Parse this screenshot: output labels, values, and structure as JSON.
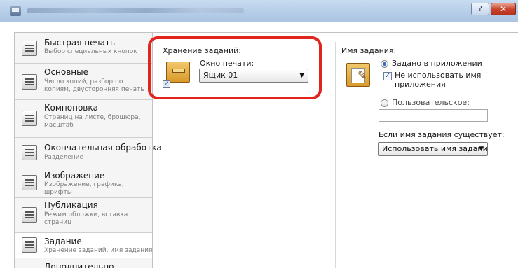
{
  "window": {
    "help_glyph": "?",
    "close_glyph": "✕"
  },
  "sidebar": {
    "items": [
      {
        "title": "Быстрая печать",
        "subtitle": "Выбор специальных кнопок",
        "icon": "quick-print-icon"
      },
      {
        "title": "Основные",
        "subtitle": "Число копий, разбор по копиям, двусторонняя печать",
        "icon": "basic-icon"
      },
      {
        "title": "Компоновка",
        "subtitle": "Страниц на листе, брошюра, масштаб",
        "icon": "layout-icon"
      },
      {
        "title": "Окончательная обработка",
        "subtitle": "Разделение",
        "icon": "finishing-icon"
      },
      {
        "title": "Изображение",
        "subtitle": "Изображение, графика, шрифты",
        "icon": "imaging-icon"
      },
      {
        "title": "Публикация",
        "subtitle": "Режим обложки, вставка страниц",
        "icon": "publishing-icon"
      },
      {
        "title": "Задание",
        "subtitle": "Хранение заданий, имя задания",
        "icon": "job-icon",
        "active": true
      },
      {
        "title": "Дополнительно",
        "subtitle": "",
        "icon": "advanced-icon"
      }
    ]
  },
  "job_storage": {
    "label": "Хранение заданий:",
    "box_label": "Окно печати:",
    "box_value": "Ящик 01",
    "checked": true,
    "check_glyph": "✓",
    "highlight_color": "#e2241e"
  },
  "job_name": {
    "label": "Имя задания:",
    "option_app": "Задано в приложении",
    "dont_use_app_name": "Не использовать имя приложения",
    "option_custom": "Пользовательское:",
    "custom_value": "",
    "exists_label": "Если имя задания существует:",
    "exists_value": "Использовать имя задания"
  }
}
